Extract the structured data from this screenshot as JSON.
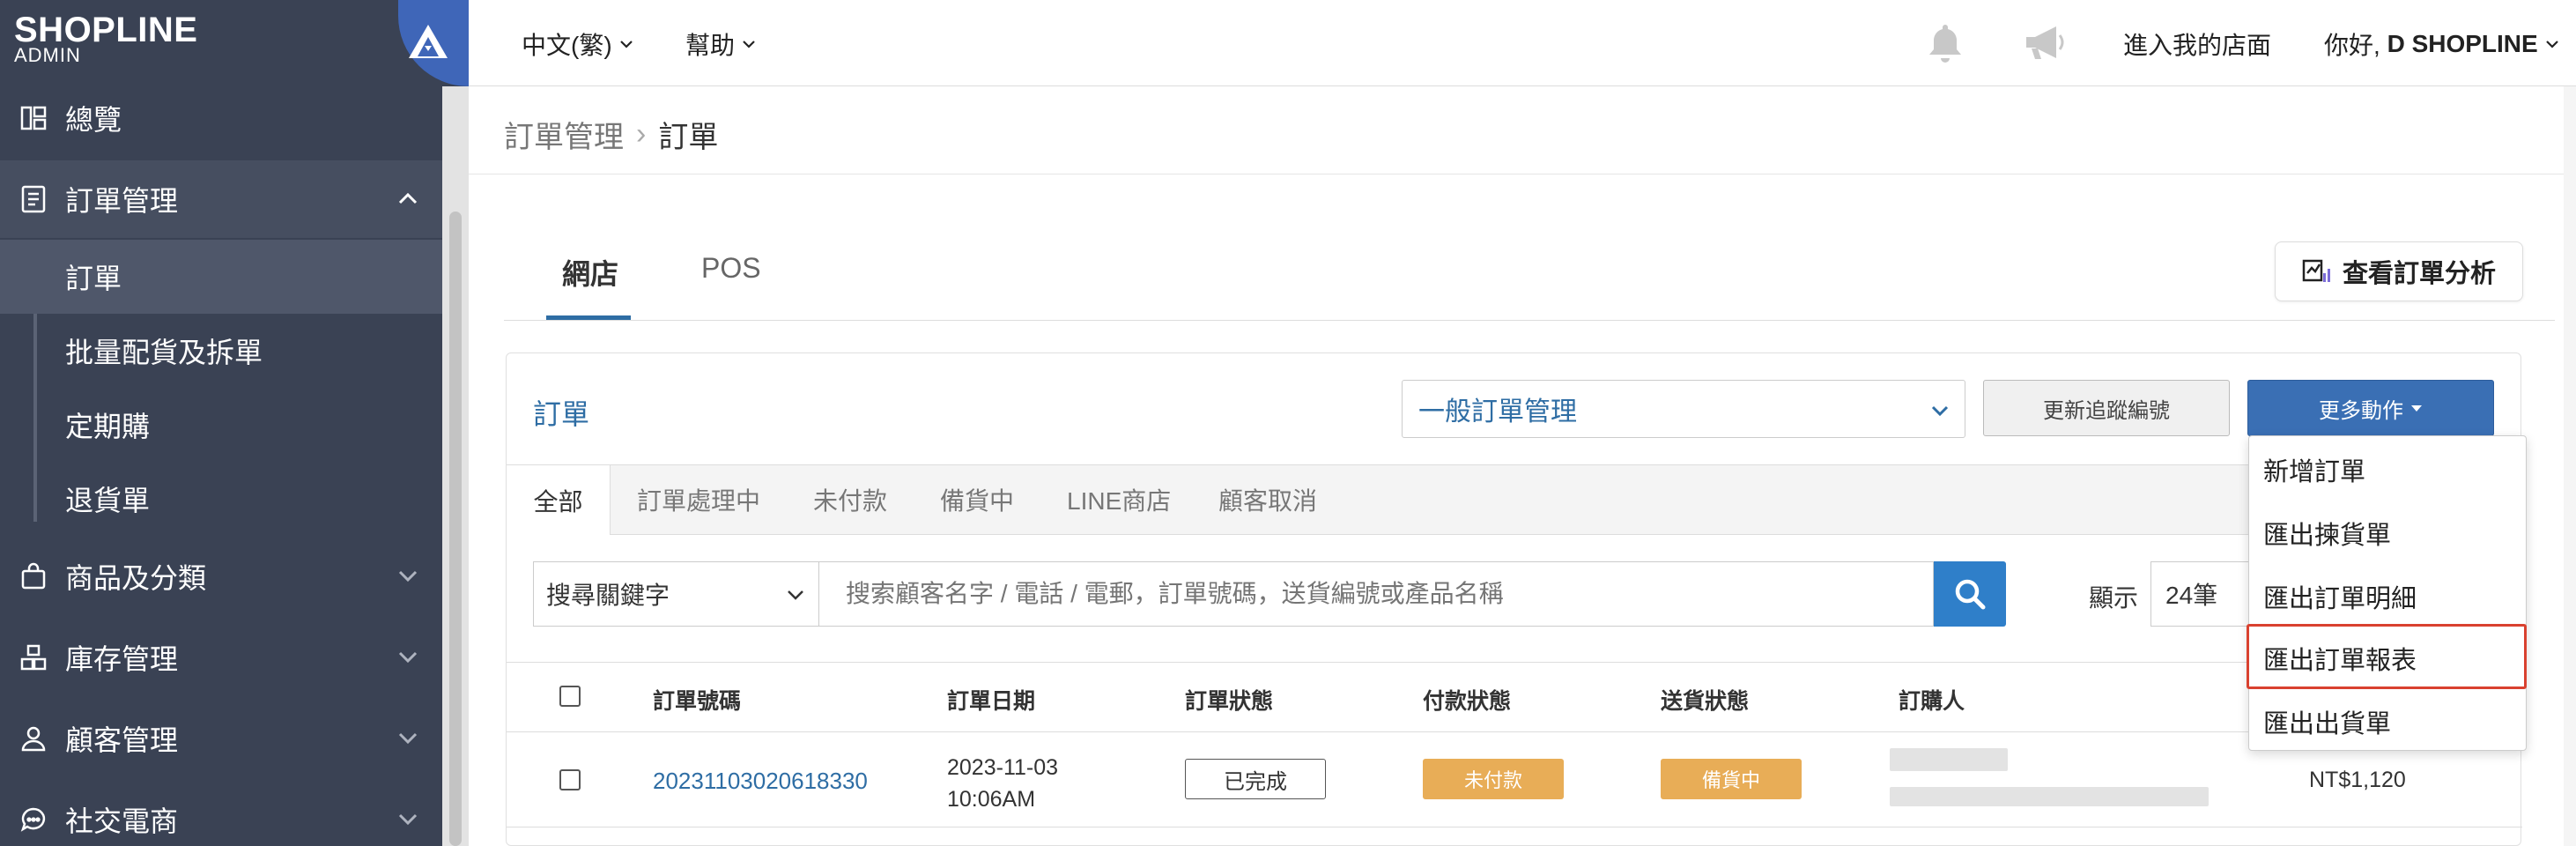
{
  "brand": {
    "name": "SHOPLINE",
    "sub": "ADMIN"
  },
  "topbar": {
    "language": "中文(繁)",
    "help": "幫助",
    "store_link": "進入我的店面",
    "greeting_prefix": "你好, ",
    "greeting_name": "D SHOPLINE"
  },
  "sidebar": {
    "items": [
      {
        "label": "總覽",
        "icon": "dashboard-icon"
      },
      {
        "label": "訂單管理",
        "icon": "order-icon"
      },
      {
        "label": "商品及分類",
        "icon": "bag-icon"
      },
      {
        "label": "庫存管理",
        "icon": "inventory-icon"
      },
      {
        "label": "顧客管理",
        "icon": "user-icon"
      },
      {
        "label": "社交電商",
        "icon": "chat-icon"
      }
    ],
    "sub_items": [
      "訂單",
      "批量配貨及拆單",
      "定期購",
      "退貨單"
    ]
  },
  "breadcrumb": {
    "parent": "訂單管理",
    "separator": "›",
    "current": "訂單"
  },
  "channel_tabs": [
    "網店",
    "POS"
  ],
  "analysis_button": "查看訂單分析",
  "card": {
    "title": "訂單",
    "mgmt_select": "一般訂單管理",
    "update_button": "更新追蹤編號",
    "more_button": "更多動作"
  },
  "status_tabs": [
    "全部",
    "訂單處理中",
    "未付款",
    "備貨中",
    "LINE商店",
    "顧客取消"
  ],
  "search": {
    "keyword_select": "搜尋關鍵字",
    "placeholder": "搜索顧客名字 / 電話 / 電郵，訂單號碼，送貨編號或產品名稱",
    "show_label": "顯示",
    "per_page": "24筆"
  },
  "table": {
    "headers": [
      "訂單號碼",
      "訂單日期",
      "訂單狀態",
      "付款狀態",
      "送貨狀態",
      "訂購人"
    ],
    "rows": [
      {
        "order_no": "20231103020618330",
        "date": "2023-11-03",
        "time": "10:06AM",
        "status": "已完成",
        "payment": "未付款",
        "delivery": "備貨中",
        "amount": "NT$1,120"
      }
    ]
  },
  "dropdown": {
    "items": [
      "新增訂單",
      "匯出揀貨單",
      "匯出訂單明細",
      "匯出訂單報表",
      "匯出出貨單"
    ],
    "highlighted": "匯出訂單報表"
  },
  "colors": {
    "sidebar_bg": "#3a4254",
    "accent": "#2e6da4",
    "primary_btn": "#3a6fb4",
    "warning_badge": "#e8ad57",
    "highlight_border": "#d9412f"
  }
}
